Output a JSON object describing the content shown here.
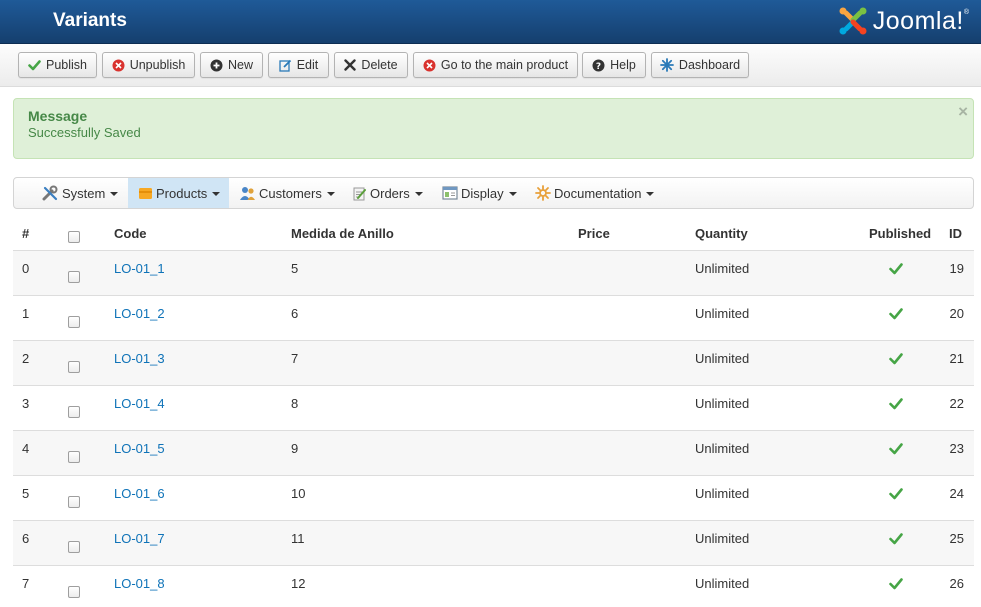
{
  "header": {
    "title": "Variants",
    "logo_text": "Joomla!",
    "logo_reg": "®"
  },
  "toolbar": {
    "buttons": [
      {
        "label": "Publish",
        "icon": "check-icon"
      },
      {
        "label": "Unpublish",
        "icon": "x-circle-icon"
      },
      {
        "label": "New",
        "icon": "plus-circle-icon"
      },
      {
        "label": "Edit",
        "icon": "edit-icon"
      },
      {
        "label": "Delete",
        "icon": "x-icon"
      },
      {
        "label": "Go to the main product",
        "icon": "x-circle-icon"
      },
      {
        "label": "Help",
        "icon": "question-circle-icon"
      },
      {
        "label": "Dashboard",
        "icon": "dashboard-icon"
      }
    ]
  },
  "message": {
    "heading": "Message",
    "text": "Successfully Saved",
    "close": "×"
  },
  "menu": {
    "items": [
      {
        "label": "System",
        "icon": "wrench-icon"
      },
      {
        "label": "Products",
        "icon": "folder-icon",
        "active": true
      },
      {
        "label": "Customers",
        "icon": "users-icon"
      },
      {
        "label": "Orders",
        "icon": "clipboard-icon"
      },
      {
        "label": "Display",
        "icon": "window-icon"
      },
      {
        "label": "Documentation",
        "icon": "gear-icon"
      }
    ]
  },
  "table": {
    "headers": {
      "num": "#",
      "code": "Code",
      "size": "Medida de Anillo",
      "price": "Price",
      "quantity": "Quantity",
      "published": "Published",
      "id": "ID"
    },
    "rows": [
      {
        "num": "0",
        "code": "LO-01_1",
        "size": "5",
        "price": "",
        "quantity": "Unlimited",
        "published": true,
        "id": "19"
      },
      {
        "num": "1",
        "code": "LO-01_2",
        "size": "6",
        "price": "",
        "quantity": "Unlimited",
        "published": true,
        "id": "20"
      },
      {
        "num": "2",
        "code": "LO-01_3",
        "size": "7",
        "price": "",
        "quantity": "Unlimited",
        "published": true,
        "id": "21"
      },
      {
        "num": "3",
        "code": "LO-01_4",
        "size": "8",
        "price": "",
        "quantity": "Unlimited",
        "published": true,
        "id": "22"
      },
      {
        "num": "4",
        "code": "LO-01_5",
        "size": "9",
        "price": "",
        "quantity": "Unlimited",
        "published": true,
        "id": "23"
      },
      {
        "num": "5",
        "code": "LO-01_6",
        "size": "10",
        "price": "",
        "quantity": "Unlimited",
        "published": true,
        "id": "24"
      },
      {
        "num": "6",
        "code": "LO-01_7",
        "size": "11",
        "price": "",
        "quantity": "Unlimited",
        "published": true,
        "id": "25"
      },
      {
        "num": "7",
        "code": "LO-01_8",
        "size": "12",
        "price": "",
        "quantity": "Unlimited",
        "published": true,
        "id": "26"
      }
    ]
  },
  "colors": {
    "header_bg": "#1a4c82",
    "link": "#0f73b8",
    "success": "#468847",
    "check": "#46a546"
  }
}
